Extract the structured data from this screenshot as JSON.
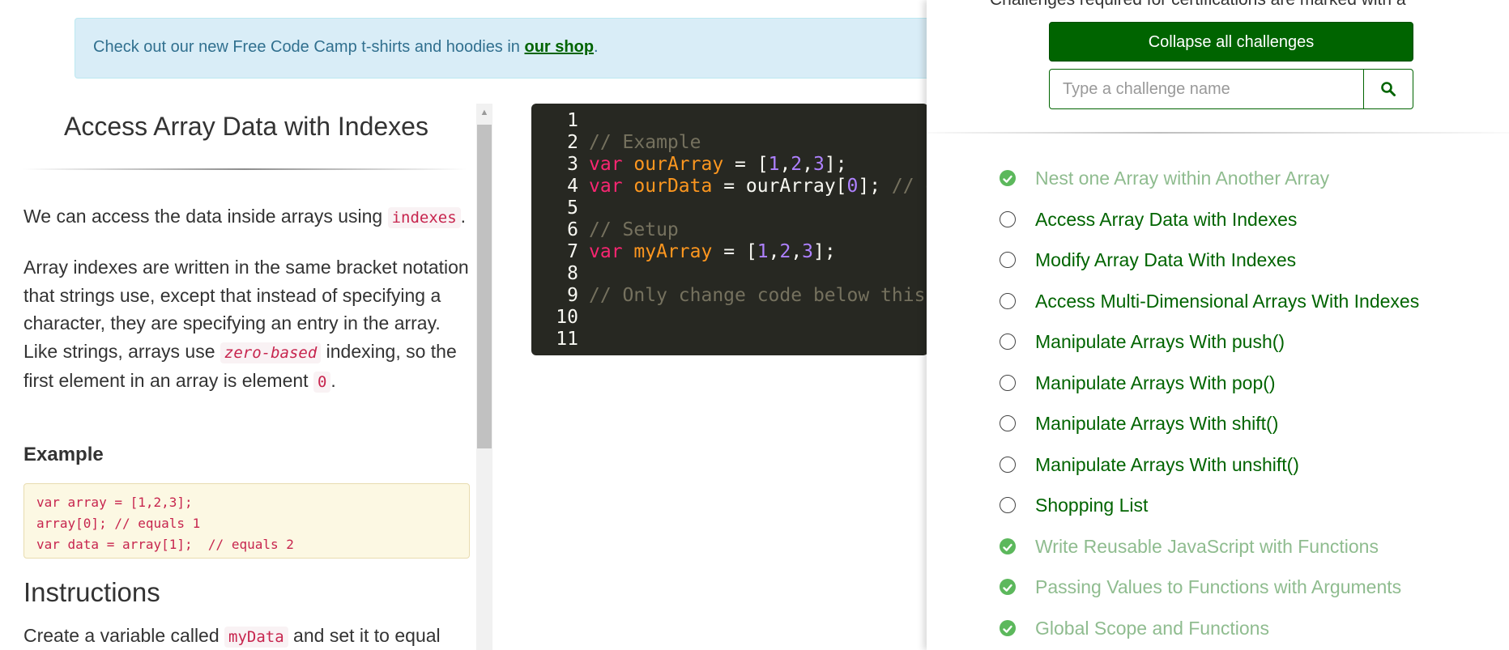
{
  "banner": {
    "text": "Check out our new Free Code Camp t-shirts and hoodies in ",
    "link": "our shop",
    "after": "."
  },
  "lesson": {
    "title": "Access Array Data with Indexes",
    "p1_before": "We can access the data inside arrays using ",
    "p1_code": "indexes",
    "p1_after": ".",
    "p2_before": "Array indexes are written in the same bracket notation that strings use, except that instead of specifying a character, they are specifying an entry in the array. Like strings, arrays use ",
    "p2_code": "zero-based",
    "p2_middle": " indexing, so the first element in an array is element ",
    "p2_code2": "0",
    "p2_after": ".",
    "example_heading": "Example",
    "example_code": "var array = [1,2,3];\narray[0]; // equals 1\nvar data = array[1];  // equals 2",
    "instructions_heading": "Instructions",
    "p3_before": "Create a variable called ",
    "p3_code": "myData",
    "p3_after": " and set it to equal"
  },
  "editor": {
    "line_numbers": [
      "1",
      "2",
      "3",
      "4",
      "5",
      "6",
      "7",
      "8",
      "9",
      "10",
      "11"
    ],
    "lines": [
      [],
      [
        {
          "t": "// Example",
          "c": "cm"
        }
      ],
      [
        {
          "t": "var",
          "c": "kw"
        },
        {
          "t": " "
        },
        {
          "t": "ourArray",
          "c": "var"
        },
        {
          "t": " = ["
        },
        {
          "t": "1",
          "c": "num"
        },
        {
          "t": ","
        },
        {
          "t": "2",
          "c": "num"
        },
        {
          "t": ","
        },
        {
          "t": "3",
          "c": "num"
        },
        {
          "t": "];"
        }
      ],
      [
        {
          "t": "var",
          "c": "kw"
        },
        {
          "t": " "
        },
        {
          "t": "ourData",
          "c": "var"
        },
        {
          "t": " = ourArray["
        },
        {
          "t": "0",
          "c": "num"
        },
        {
          "t": "]; "
        },
        {
          "t": "// e",
          "c": "cm"
        }
      ],
      [],
      [
        {
          "t": "// Setup",
          "c": "cm"
        }
      ],
      [
        {
          "t": "var",
          "c": "kw"
        },
        {
          "t": " "
        },
        {
          "t": "myArray",
          "c": "var"
        },
        {
          "t": " = ["
        },
        {
          "t": "1",
          "c": "num"
        },
        {
          "t": ","
        },
        {
          "t": "2",
          "c": "num"
        },
        {
          "t": ","
        },
        {
          "t": "3",
          "c": "num"
        },
        {
          "t": "];"
        }
      ],
      [],
      [
        {
          "t": "// Only change code below this",
          "c": "cm"
        }
      ],
      [],
      []
    ]
  },
  "panel": {
    "note": "Challenges required for certifications are marked with a",
    "collapse_label": "Collapse all challenges",
    "search_placeholder": "Type a challenge name",
    "challenges": [
      {
        "label": "Nest one Array within Another Array",
        "completed": true
      },
      {
        "label": "Access Array Data with Indexes",
        "completed": false
      },
      {
        "label": "Modify Array Data With Indexes",
        "completed": false
      },
      {
        "label": "Access Multi-Dimensional Arrays With Indexes",
        "completed": false
      },
      {
        "label": "Manipulate Arrays With push()",
        "completed": false
      },
      {
        "label": "Manipulate Arrays With pop()",
        "completed": false
      },
      {
        "label": "Manipulate Arrays With shift()",
        "completed": false
      },
      {
        "label": "Manipulate Arrays With unshift()",
        "completed": false
      },
      {
        "label": "Shopping List",
        "completed": false
      },
      {
        "label": "Write Reusable JavaScript with Functions",
        "completed": true
      },
      {
        "label": "Passing Values to Functions with Arguments",
        "completed": true
      },
      {
        "label": "Global Scope and Functions",
        "completed": true
      }
    ]
  },
  "colors": {
    "brand_green": "#006400",
    "completed_green": "#8fbc8f",
    "check_green": "#5cb85c",
    "banner_bg": "#d9edf7",
    "editor_bg": "#272822"
  }
}
